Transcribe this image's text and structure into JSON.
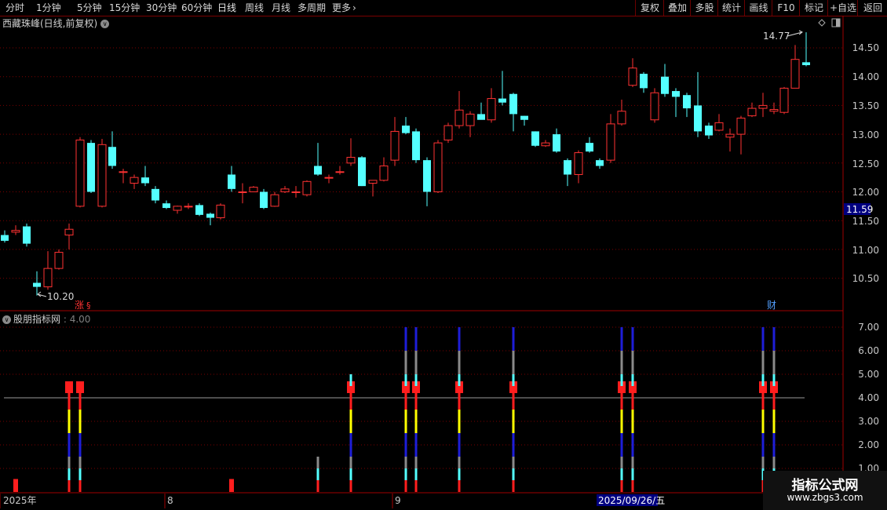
{
  "toolbar": {
    "periods": [
      "分时",
      "1分钟",
      "5分钟",
      "15分钟",
      "30分钟",
      "60分钟",
      "日线",
      "周线",
      "月线",
      "多周期",
      "更多"
    ],
    "active_period": "日线",
    "more_icon": "chevron-right-icon",
    "right_buttons": [
      "复权",
      "叠加",
      "多股",
      "统计",
      "画线",
      "F10",
      "标记",
      "+自选",
      "返回"
    ]
  },
  "main_chart": {
    "title": "西藏珠峰(日线,前复权)",
    "title_icon": "chevron-down-icon",
    "price_labels": [
      "14.50",
      "14.00",
      "13.50",
      "13.00",
      "12.50",
      "12.00",
      "11.50",
      "11.00",
      "10.50"
    ],
    "current_price": "11.59",
    "high_label": "14.77",
    "low_label": "10.20",
    "badge_zhang": "涨",
    "badge_fin": "财",
    "corner_icons": [
      "diamond-icon",
      "window-icon"
    ],
    "colors": {
      "up": "#ff3232",
      "down": "#54ffff",
      "grid": "#7a0000",
      "price_box": "#000080"
    }
  },
  "indicator": {
    "name": "股朋指标网",
    "value": "4.00",
    "icon": "chevron-down-icon",
    "axis_labels": [
      "7.00",
      "6.00",
      "5.00",
      "4.00",
      "3.00",
      "2.00",
      "1.00"
    ]
  },
  "xaxis": {
    "labels": [
      "2025年",
      "8",
      "9",
      "2025/09/26/五"
    ]
  },
  "watermark": {
    "line1": "指标公式网",
    "line2": "www.zbgs3.com"
  }
}
